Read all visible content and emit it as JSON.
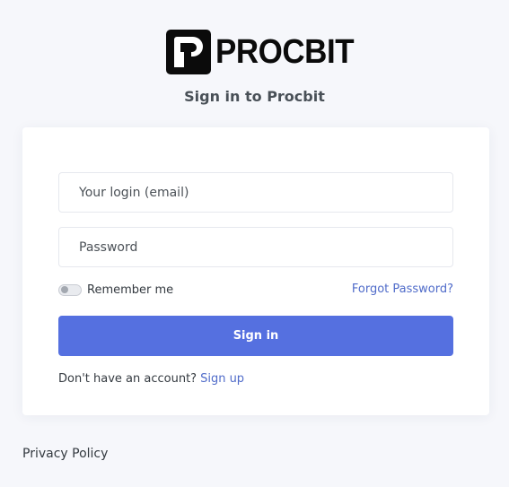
{
  "brand": {
    "logo_text": "PROCBIT",
    "logo_icon": "procbit-p-logo-icon"
  },
  "heading": "Sign in to Procbit",
  "form": {
    "email_placeholder": "Your login (email)",
    "password_placeholder": "Password",
    "remember_label": "Remember me",
    "remember_checked": false,
    "forgot_label": "Forgot Password?",
    "submit_label": "Sign in",
    "signup_prompt": "Don't have an account?",
    "signup_link": "Sign up"
  },
  "footer": {
    "privacy_label": "Privacy Policy"
  },
  "colors": {
    "primary": "#5570e0",
    "link": "#4f6bc9",
    "background": "#f6f7fb"
  }
}
